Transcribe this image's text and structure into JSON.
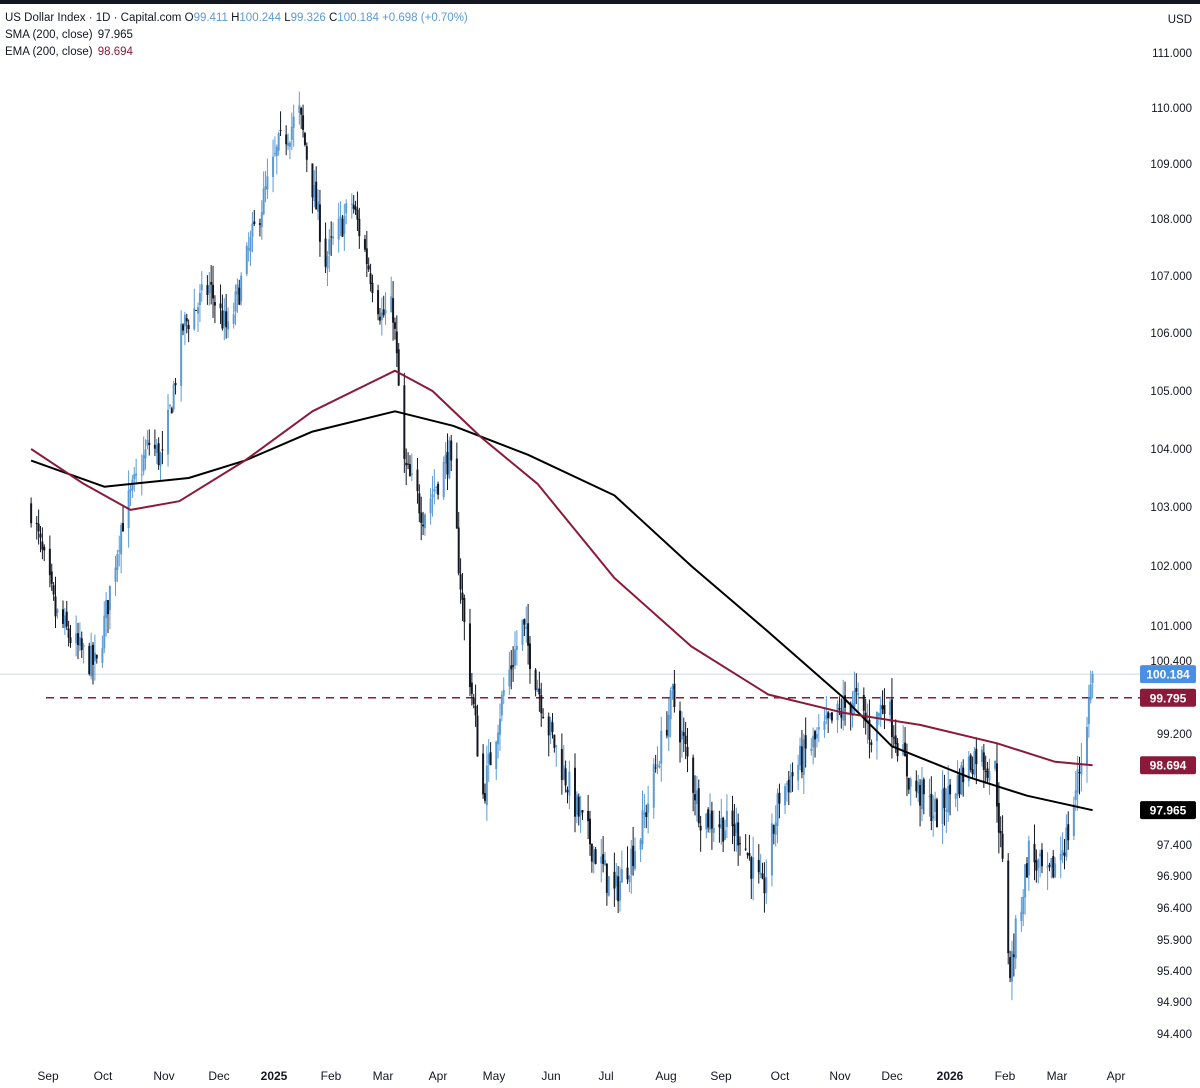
{
  "legend": {
    "symbol": "US Dollar Index · 1D · Capital.com",
    "o_label": "O",
    "o_value": "99.411",
    "h_label": "H",
    "h_value": "100.244",
    "l_label": "L",
    "l_value": "99.326",
    "c_label": "C",
    "c_value": "100.184",
    "change": "+0.698 (+0.70%)",
    "sma_label": "SMA (200, close)",
    "sma_value": "97.965",
    "ema_label": "EMA (200, close)",
    "ema_value": "98.694"
  },
  "colors": {
    "candle_up": "#5b9bd5",
    "candle_down": "#131722",
    "sma": "#000000",
    "ema": "#8b1a3a",
    "current_price": "#4a90e2",
    "resistance": "#8b1a3a"
  },
  "chart_data": {
    "type": "candlestick",
    "currency": "USD",
    "ylim": [
      94.2,
      111.1
    ],
    "y_ticks": [
      "111.000",
      "110.000",
      "109.000",
      "108.000",
      "107.000",
      "106.000",
      "105.000",
      "104.000",
      "103.000",
      "102.000",
      "101.000",
      "100.400",
      "99.200",
      "97.400",
      "96.900",
      "96.400",
      "95.900",
      "95.400",
      "94.900",
      "94.400"
    ],
    "x_ticks": [
      "Sep",
      "Oct",
      "Nov",
      "Dec",
      "2025",
      "Feb",
      "Mar",
      "Apr",
      "May",
      "Jun",
      "Jul",
      "Aug",
      "Sep",
      "Oct",
      "Nov",
      "Dec",
      "2026",
      "Feb",
      "Mar",
      "Apr"
    ],
    "x_tick_bold": [
      false,
      false,
      false,
      false,
      true,
      false,
      false,
      false,
      false,
      false,
      false,
      false,
      false,
      false,
      false,
      false,
      true,
      false,
      false,
      false
    ],
    "price_path": [
      [
        "2024-08-23",
        103.0
      ],
      [
        "2024-09-05",
        101.2
      ],
      [
        "2024-09-17",
        100.6
      ],
      [
        "2024-09-27",
        100.3
      ],
      [
        "2024-10-10",
        102.7
      ],
      [
        "2024-10-25",
        104.1
      ],
      [
        "2024-11-01",
        103.8
      ],
      [
        "2024-11-12",
        106.1
      ],
      [
        "2024-11-26",
        106.8
      ],
      [
        "2024-12-06",
        106.0
      ],
      [
        "2024-12-20",
        107.8
      ],
      [
        "2025-01-02",
        109.3
      ],
      [
        "2025-01-13",
        109.9
      ],
      [
        "2025-01-27",
        107.3
      ],
      [
        "2025-02-10",
        108.3
      ],
      [
        "2025-02-26",
        106.3
      ],
      [
        "2025-03-04",
        106.4
      ],
      [
        "2025-03-10",
        103.7
      ],
      [
        "2025-03-20",
        102.9
      ],
      [
        "2025-04-03",
        103.9
      ],
      [
        "2025-04-11",
        101.0
      ],
      [
        "2025-04-21",
        98.2
      ],
      [
        "2025-05-02",
        99.9
      ],
      [
        "2025-05-12",
        101.0
      ],
      [
        "2025-05-26",
        99.3
      ],
      [
        "2025-06-12",
        97.8
      ],
      [
        "2025-06-30",
        96.6
      ],
      [
        "2025-07-14",
        97.6
      ],
      [
        "2025-07-31",
        99.8
      ],
      [
        "2025-08-15",
        97.9
      ],
      [
        "2025-09-05",
        97.6
      ],
      [
        "2025-09-17",
        96.6
      ],
      [
        "2025-09-26",
        98.2
      ],
      [
        "2025-10-10",
        98.9
      ],
      [
        "2025-10-30",
        99.6
      ],
      [
        "2025-11-05",
        99.8
      ],
      [
        "2025-11-14",
        99.2
      ],
      [
        "2025-11-21",
        99.8
      ],
      [
        "2025-12-05",
        98.4
      ],
      [
        "2025-12-19",
        97.9
      ],
      [
        "2026-01-09",
        98.9
      ],
      [
        "2026-01-19",
        98.6
      ],
      [
        "2026-01-27",
        95.4
      ],
      [
        "2026-02-06",
        97.3
      ],
      [
        "2026-02-16",
        96.8
      ],
      [
        "2026-02-27",
        97.6
      ],
      [
        "2026-03-06",
        98.8
      ],
      [
        "2026-03-12",
        100.184
      ]
    ],
    "series": [
      {
        "name": "SMA (200, close)",
        "points": [
          [
            "2024-08-23",
            103.8
          ],
          [
            "2024-10-01",
            103.35
          ],
          [
            "2024-11-15",
            103.5
          ],
          [
            "2024-12-15",
            103.8
          ],
          [
            "2025-01-20",
            104.3
          ],
          [
            "2025-03-05",
            104.65
          ],
          [
            "2025-04-05",
            104.4
          ],
          [
            "2025-05-15",
            103.9
          ],
          [
            "2025-06-30",
            103.2
          ],
          [
            "2025-08-10",
            102.0
          ],
          [
            "2025-09-20",
            100.9
          ],
          [
            "2025-10-30",
            99.8
          ],
          [
            "2025-11-25",
            99.0
          ],
          [
            "2026-01-05",
            98.5
          ],
          [
            "2026-02-05",
            98.2
          ],
          [
            "2026-03-12",
            97.965
          ]
        ]
      },
      {
        "name": "EMA (200, close)",
        "points": [
          [
            "2024-08-23",
            104.0
          ],
          [
            "2024-09-20",
            103.4
          ],
          [
            "2024-10-15",
            102.95
          ],
          [
            "2024-11-10",
            103.1
          ],
          [
            "2024-12-15",
            103.8
          ],
          [
            "2025-01-20",
            104.65
          ],
          [
            "2025-03-05",
            105.35
          ],
          [
            "2025-03-25",
            105.0
          ],
          [
            "2025-04-20",
            104.2
          ],
          [
            "2025-05-20",
            103.4
          ],
          [
            "2025-06-30",
            101.8
          ],
          [
            "2025-08-10",
            100.65
          ],
          [
            "2025-09-20",
            99.85
          ],
          [
            "2025-10-30",
            99.55
          ],
          [
            "2025-12-10",
            99.35
          ],
          [
            "2026-01-20",
            99.05
          ],
          [
            "2026-02-20",
            98.75
          ],
          [
            "2026-03-12",
            98.694
          ]
        ]
      }
    ],
    "price_labels": [
      {
        "value": "100.184",
        "kind": "current"
      },
      {
        "value": "99.795",
        "kind": "resistance"
      },
      {
        "value": "98.694",
        "kind": "ema"
      },
      {
        "value": "97.965",
        "kind": "sma"
      }
    ],
    "resistance_level": 99.795,
    "current_price": 100.184,
    "grid": false
  }
}
